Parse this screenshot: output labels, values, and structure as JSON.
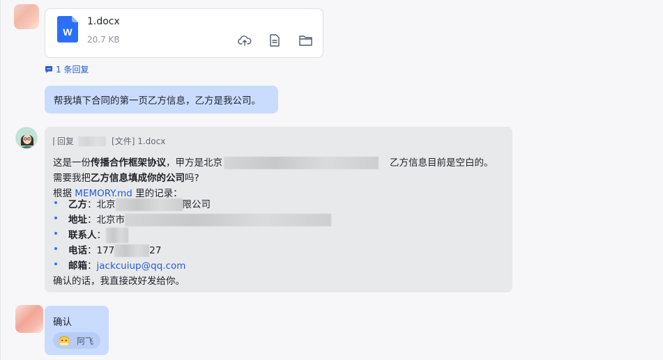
{
  "file": {
    "name": "1.docx",
    "size": "20.7 KB",
    "icon_letter": "W",
    "actions": [
      "cloud-upload-icon",
      "file-icon",
      "folder-icon"
    ]
  },
  "reply_count": "1 条回复",
  "user_message": "帮我填下合同的第一页乙方信息，乙方是我公司。",
  "bot_message": {
    "quote_prefix": "回复",
    "quote_file": "[文件] 1.docx",
    "line1_a": "这是一份",
    "line1_b": "传播合作框架协议",
    "line1_c": "，甲方是北京",
    "line1_d": "乙方信息目前是空白的。",
    "line2_a": "需要我把",
    "line2_b": "乙方信息填成你的公司",
    "line2_c": "吗?",
    "line3_a": "根据 ",
    "line3_link": "MEMORY.md",
    "line3_b": " 里的记录：",
    "items": [
      {
        "label": "乙方",
        "value_a": "：北京",
        "value_b": "限公司"
      },
      {
        "label": "地址",
        "value_a": "：北京市",
        "value_b": ""
      },
      {
        "label": "联系人",
        "value_a": "：",
        "value_b": ""
      },
      {
        "label": "电话",
        "value_a": "：177",
        "value_b": "27"
      },
      {
        "label": "邮箱",
        "value_a": "：",
        "value_b": "jackcuiup@qq.com"
      }
    ],
    "closing": "确认的话，我直接改好发给你。"
  },
  "confirm_message": "确认",
  "reaction": {
    "name": "阿飞"
  },
  "colors": {
    "user_bubble": "#cadcfd",
    "bot_bubble": "#e8e9eb",
    "link": "#245bdb",
    "word_blue": "#2b6ff4"
  }
}
